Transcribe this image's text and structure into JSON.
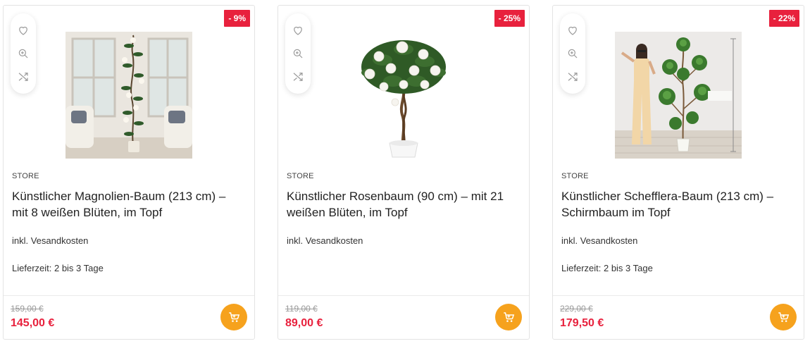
{
  "colors": {
    "discount_badge": "#e8213d",
    "sale_price": "#e8213d",
    "cart_button": "#f6a21d",
    "old_price": "#9a9a9a"
  },
  "card_actions": {
    "icons": [
      "heart-icon",
      "zoom-in-icon",
      "shuffle-icon"
    ],
    "cart_icon": "shopping-cart-icon"
  },
  "products": [
    {
      "discount": "- 9%",
      "image": "artificial magnolia tree in living room",
      "brand": "STORE",
      "title": "Künstlicher Magnolien-Baum (213 cm) – mit 8 weißen Blüten, im Topf",
      "shipping": "inkl. Vesandkosten",
      "delivery": "Lieferzeit: 2 bis 3 Tage",
      "old_price": "159,00 €",
      "price": "145,00 €"
    },
    {
      "discount": "- 25%",
      "image": "artificial rose tree in white pot",
      "brand": "STORE",
      "title": "Künstlicher Rosenbaum (90 cm) – mit 21 weißen Blüten, im Topf",
      "shipping": "inkl. Vesandkosten",
      "delivery": "",
      "old_price": "119,00 €",
      "price": "89,00 €"
    },
    {
      "discount": "- 22%",
      "image": "artificial schefflera tree with woman for scale",
      "brand": "STORE",
      "title": "Künstlicher Schefflera-Baum (213 cm) – Schirmbaum im Topf",
      "shipping": "inkl. Vesandkosten",
      "delivery": "Lieferzeit: 2 bis 3 Tage",
      "old_price": "229,00 €",
      "price": "179,50 €"
    }
  ]
}
